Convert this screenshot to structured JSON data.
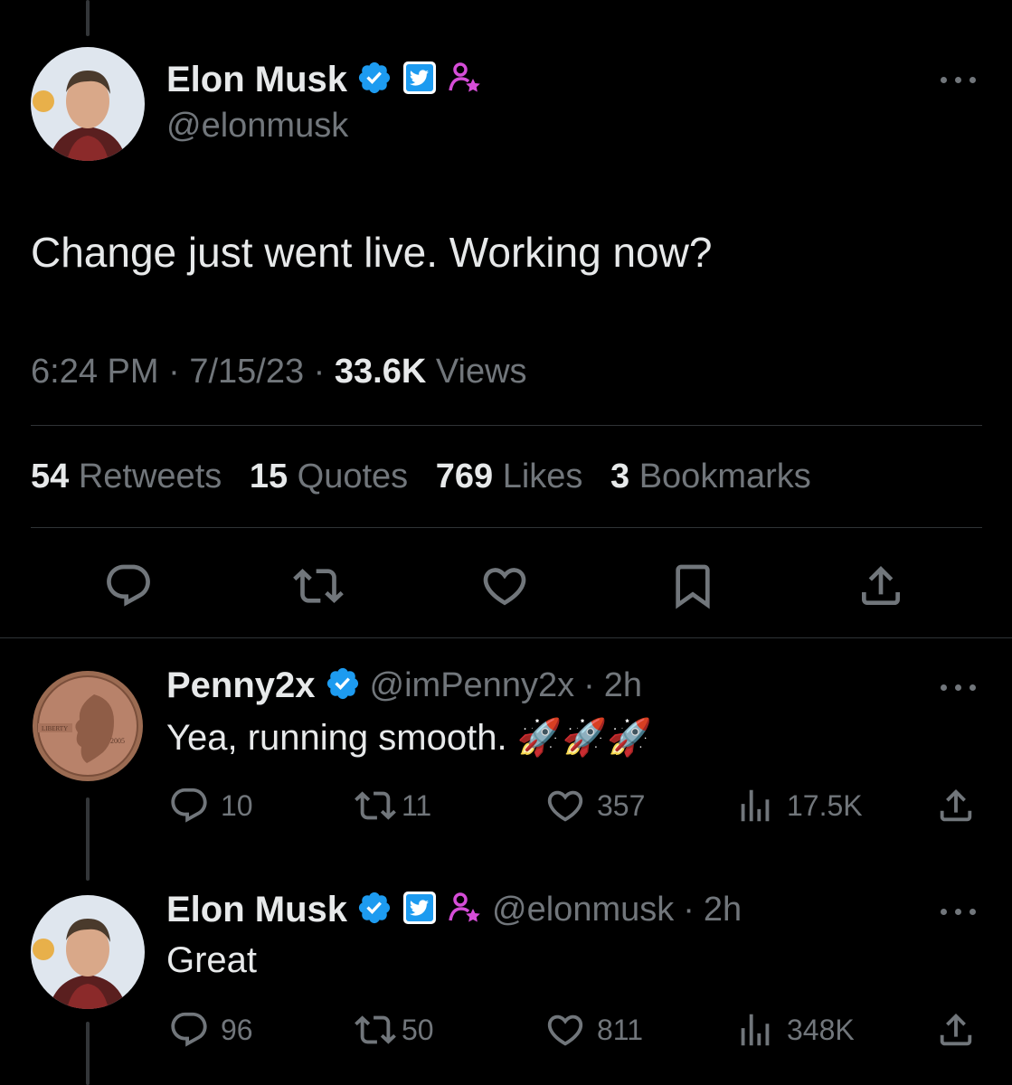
{
  "main_tweet": {
    "author": {
      "name": "Elon Musk",
      "handle": "@elonmusk",
      "badges": [
        "verified-badge-icon",
        "twitter-affiliate-badge-icon",
        "person-star-badge-icon"
      ]
    },
    "text": "Change just went live. Working now?",
    "time": "6:24 PM",
    "date": "7/15/23",
    "views_count": "33.6K",
    "views_label": "Views",
    "stats": [
      {
        "count": "54",
        "label": "Retweets"
      },
      {
        "count": "15",
        "label": "Quotes"
      },
      {
        "count": "769",
        "label": "Likes"
      },
      {
        "count": "3",
        "label": "Bookmarks"
      }
    ],
    "actions": [
      "reply-icon",
      "retweet-icon",
      "like-icon",
      "bookmark-icon",
      "share-icon"
    ]
  },
  "replies": [
    {
      "name": "Penny2x",
      "handle": "@imPenny2x",
      "time": "2h",
      "text": "Yea, running smooth.",
      "emoji": "🚀🚀🚀",
      "reply_count": "10",
      "retweet_count": "11",
      "like_count": "357",
      "view_count": "17.5K"
    },
    {
      "name": "Elon Musk",
      "handle": "@elonmusk",
      "time": "2h",
      "text": "Great",
      "reply_count": "96",
      "retweet_count": "50",
      "like_count": "811",
      "view_count": "348K"
    }
  ],
  "colors": {
    "background": "#000000",
    "text": "#e7e9ea",
    "muted": "#71767b",
    "verified": "#1d9bf0",
    "affiliate_pink": "#d64dd8",
    "divider": "#2f3336"
  }
}
